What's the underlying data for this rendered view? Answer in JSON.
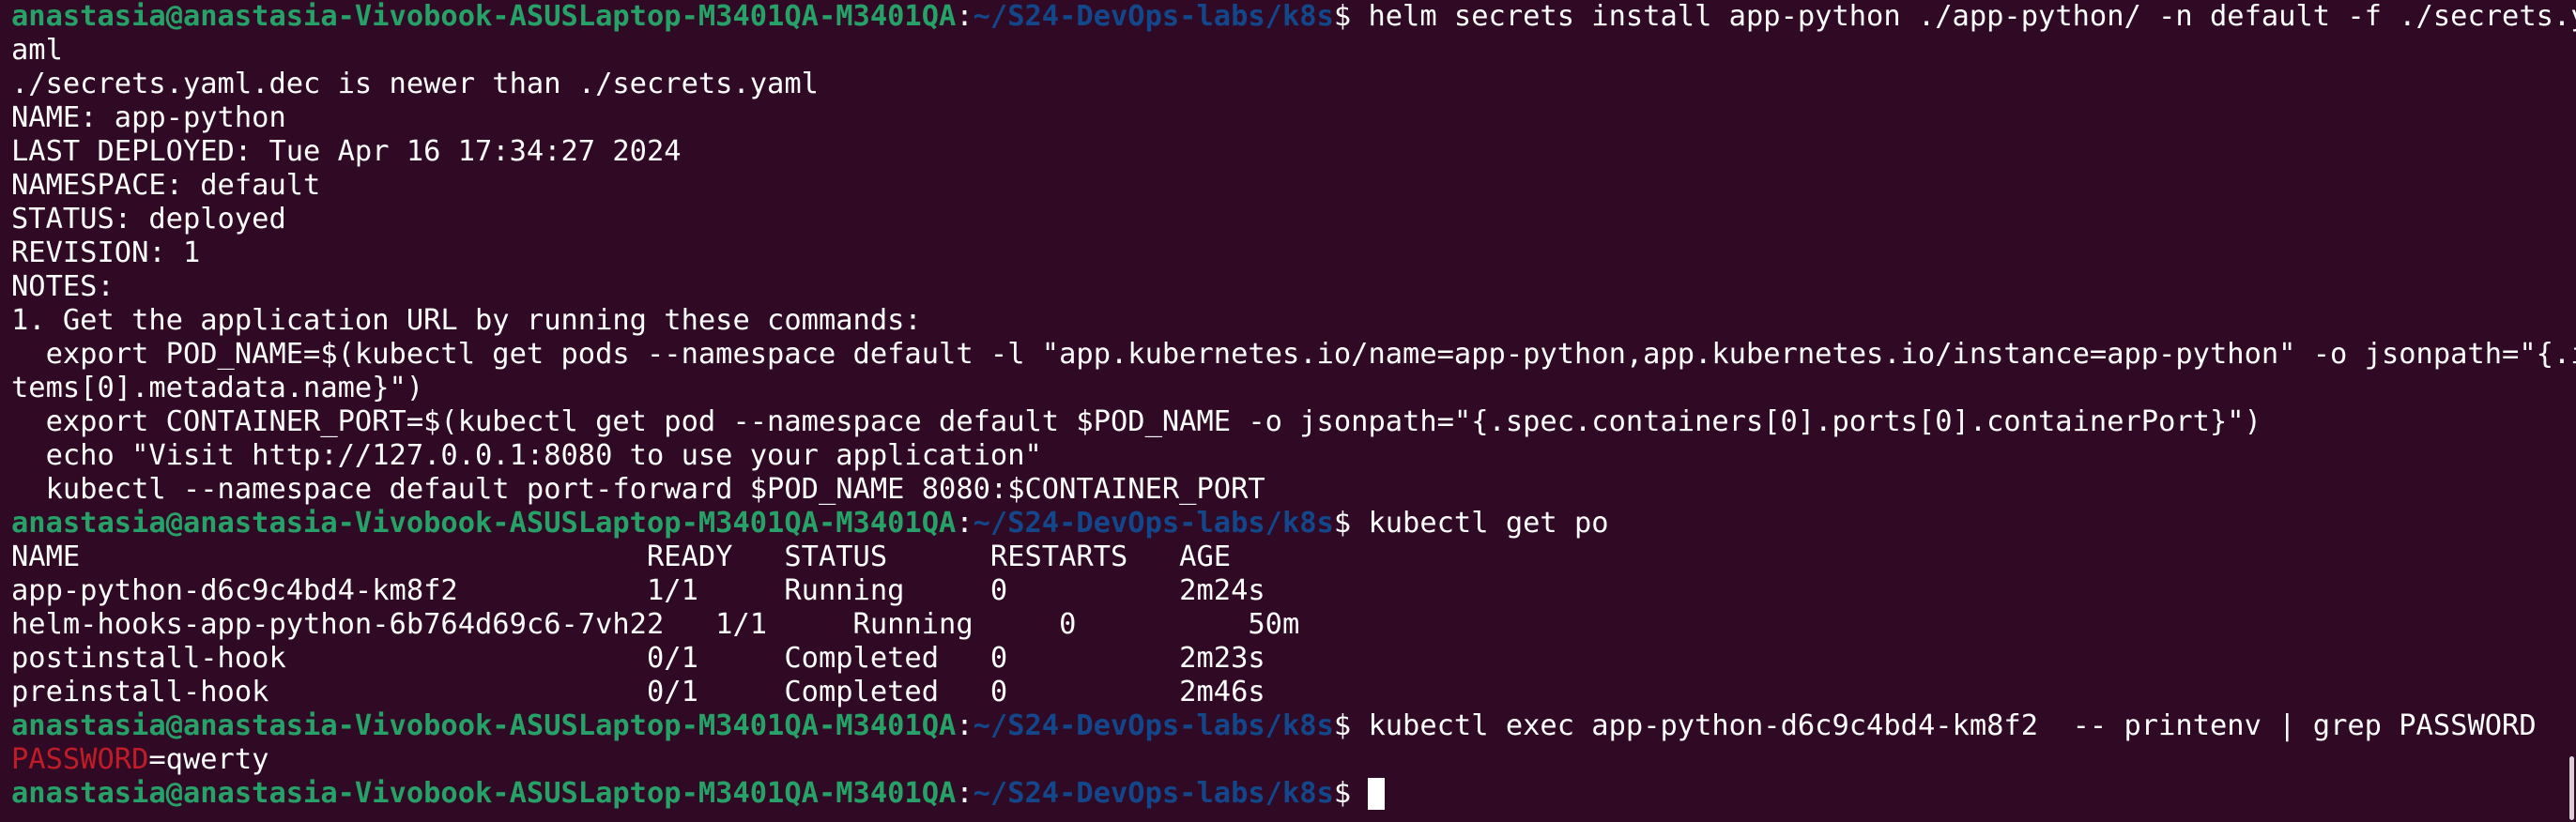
{
  "prompt": {
    "user_host": "anastasia@anastasia-Vivobook-ASUSLaptop-M3401QA-M3401QA",
    "sep": ":",
    "path": "~/S24-DevOps-labs/k8s",
    "dollar": "$ "
  },
  "commands": {
    "c1": "helm secrets install app-python ./app-python/ -n default -f ./secrets.y",
    "c2": "kubectl get po",
    "c3": "kubectl exec app-python-d6c9c4bd4-km8f2  -- printenv | grep PASSWORD"
  },
  "output": {
    "wrap1": "aml",
    "l1": "./secrets.yaml.dec is newer than ./secrets.yaml",
    "l2": "NAME: app-python",
    "l3": "LAST DEPLOYED: Tue Apr 16 17:34:27 2024",
    "l4": "NAMESPACE: default",
    "l5": "STATUS: deployed",
    "l6": "REVISION: 1",
    "l7": "NOTES:",
    "l8": "1. Get the application URL by running these commands:",
    "l9": "  export POD_NAME=$(kubectl get pods --namespace default -l \"app.kubernetes.io/name=app-python,app.kubernetes.io/instance=app-python\" -o jsonpath=\"{.i",
    "l10": "tems[0].metadata.name}\")",
    "l11": "  export CONTAINER_PORT=$(kubectl get pod --namespace default $POD_NAME -o jsonpath=\"{.spec.containers[0].ports[0].containerPort}\")",
    "l12": "  echo \"Visit http://127.0.0.1:8080 to use your application\"",
    "l13": "  kubectl --namespace default port-forward $POD_NAME 8080:$CONTAINER_PORT"
  },
  "pods_table": {
    "header": "NAME                                 READY   STATUS      RESTARTS   AGE",
    "rows": [
      "app-python-d6c9c4bd4-km8f2           1/1     Running     0          2m24s",
      "helm-hooks-app-python-6b764d69c6-7vh22   1/1     Running     0          50m",
      "postinstall-hook                     0/1     Completed   0          2m23s",
      "preinstall-hook                      0/1     Completed   0          2m46s"
    ]
  },
  "env_result": {
    "match": "PASSWORD",
    "rest": "=qwerty"
  },
  "colors": {
    "background": "#300a24",
    "user_host": "#26a269",
    "path": "#12488b",
    "match": "#c01c28",
    "text": "#ffffff"
  }
}
